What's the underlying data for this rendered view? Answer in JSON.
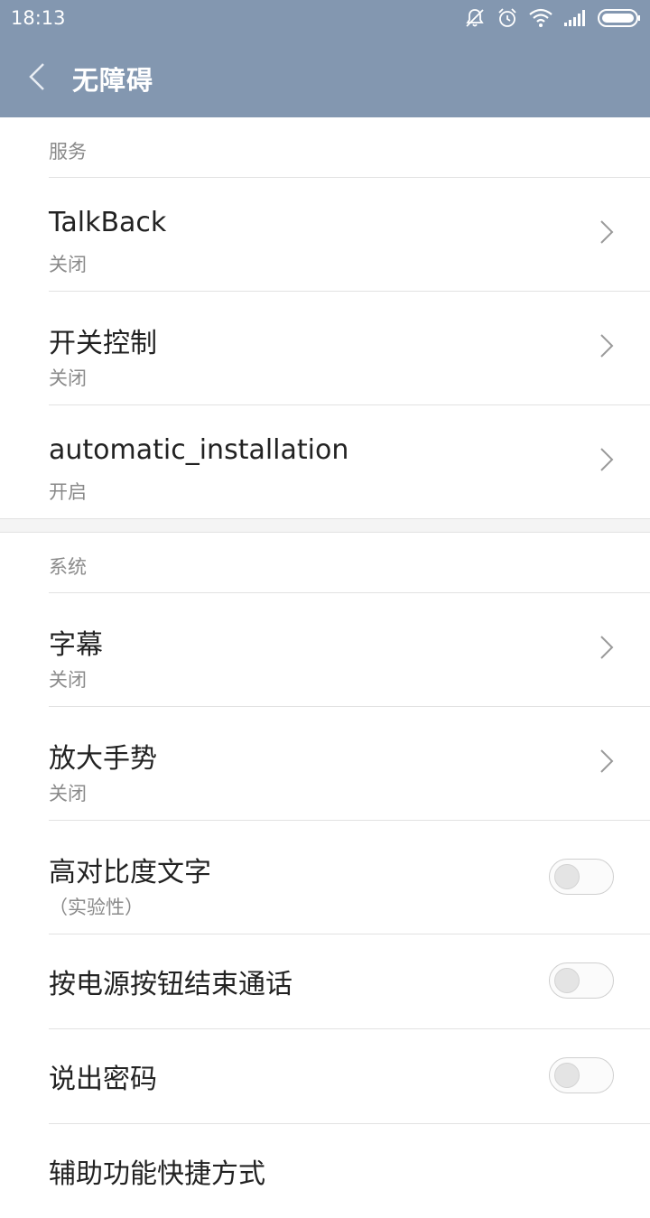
{
  "status_bar": {
    "time": "18:13",
    "icons": [
      "mute-icon",
      "alarm-icon",
      "wifi-icon",
      "signal-icon",
      "battery-icon"
    ]
  },
  "app_bar": {
    "title": "无障碍",
    "back_icon": "chevron-left-icon"
  },
  "sections": {
    "services": {
      "header": "服务",
      "items": [
        {
          "title": "TalkBack",
          "subtitle": "关闭"
        },
        {
          "title": "开关控制",
          "subtitle": "关闭"
        },
        {
          "title": "automatic_installation",
          "subtitle": "开启"
        }
      ]
    },
    "system": {
      "header": "系统",
      "items": [
        {
          "title": "字幕",
          "subtitle": "关闭"
        },
        {
          "title": "放大手势",
          "subtitle": "关闭"
        },
        {
          "title": "高对比度文字",
          "subtitle": "（实验性）",
          "toggle_on": false
        },
        {
          "title": "按电源按钮结束通话",
          "toggle_on": false
        },
        {
          "title": "说出密码",
          "toggle_on": false
        },
        {
          "title": "辅助功能快捷方式"
        }
      ]
    }
  },
  "colors": {
    "header_bg": "#8397b0",
    "secondary_text": "#8a8a8a"
  }
}
